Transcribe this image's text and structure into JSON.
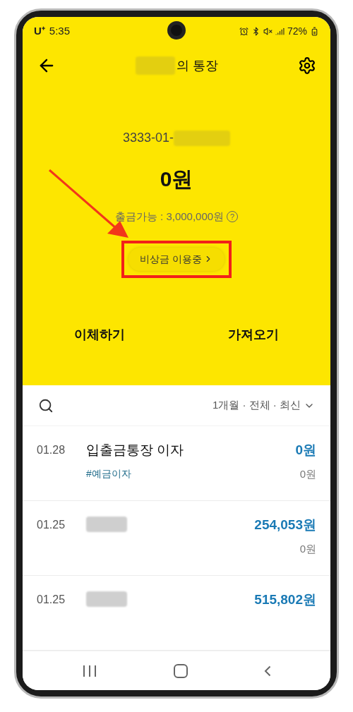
{
  "status_bar": {
    "carrier": "U⁺",
    "time": "5:35",
    "battery": "72%"
  },
  "header": {
    "title_suffix": "의 통장",
    "title_redacted": true
  },
  "account": {
    "number_prefix": "3333-01-",
    "number_redacted": true,
    "balance": "0원",
    "withdrawable": "출금가능 : 3,000,000원",
    "help_mark": "?"
  },
  "emergency_button": {
    "label": "비상금 이용중",
    "highlighted": true
  },
  "actions": [
    "이체하기",
    "가져오기"
  ],
  "filter": {
    "label": "1개월 · 전체 · 최신"
  },
  "transactions": [
    {
      "kind": "named",
      "date": "01.28",
      "title": "입출금통장 이자",
      "tag": "#예금이자",
      "amount": "0원",
      "balance": "0원"
    },
    {
      "kind": "redacted",
      "date": "01.25",
      "amount": "254,053원",
      "balance": "0원"
    },
    {
      "kind": "redacted",
      "date": "01.25",
      "amount": "515,802원"
    }
  ]
}
